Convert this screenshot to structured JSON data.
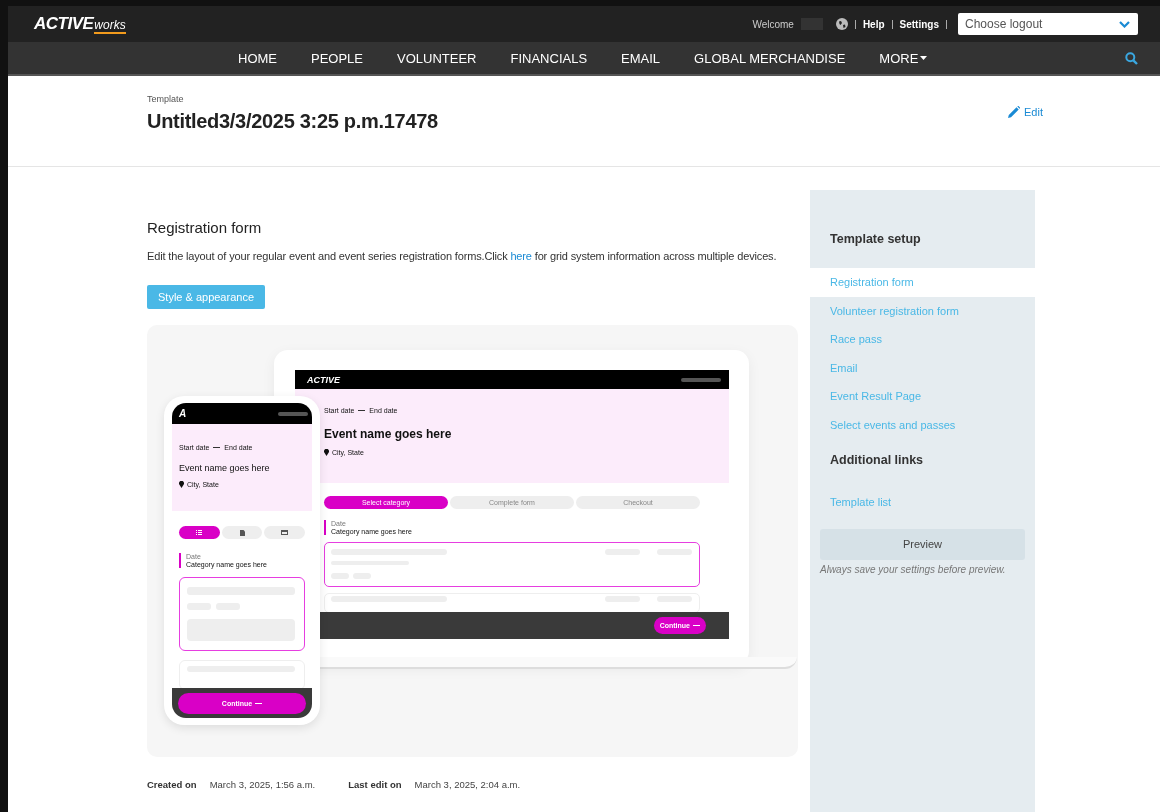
{
  "top_bar": {
    "logo": "ACTIVE",
    "logo_suffix": "works",
    "welcome": "Welcome",
    "help": "Help",
    "settings": "Settings",
    "logout_select": {
      "placeholder": "Choose logout"
    }
  },
  "nav": [
    {
      "label": "HOME",
      "kind": "link"
    },
    {
      "label": "PEOPLE",
      "kind": "link"
    },
    {
      "label": "VOLUNTEER",
      "kind": "link"
    },
    {
      "label": "FINANCIALS",
      "kind": "link"
    },
    {
      "label": "EMAIL",
      "kind": "link"
    },
    {
      "label": "GLOBAL MERCHANDISE",
      "kind": "link"
    },
    {
      "label": "MORE",
      "kind": "menu"
    }
  ],
  "header": {
    "eyebrow": "Template",
    "title": "Untitled3/3/2025 3:25 p.m.17478",
    "edit": "Edit"
  },
  "section": {
    "title": "Registration form",
    "description_before": "Edit the layout of your regular event and event series registration forms.Click",
    "link": "here",
    "description_after": "for grid system information across multiple devices.",
    "button": "Style & appearance"
  },
  "preview": {
    "desktop": {
      "logo": "ACTIVE",
      "start": "Start date",
      "end": "End date",
      "event_name": "Event name goes here",
      "location": "City, State",
      "steps": [
        {
          "label": "Select category",
          "selected": true
        },
        {
          "label": "Complete form",
          "selected": false
        },
        {
          "label": "Checkout",
          "selected": false
        }
      ],
      "category_label": "Date",
      "category_name": "Category name goes here",
      "continue": "Continue"
    },
    "mobile": {
      "logo": "A",
      "start": "Start date",
      "end": "End date",
      "event_name": "Event name goes here",
      "location": "City, State",
      "tabs": [
        {
          "kind": "list",
          "selected": true
        },
        {
          "kind": "document",
          "selected": false
        },
        {
          "kind": "card",
          "selected": false
        }
      ],
      "category_label": "Date",
      "category_name": "Category name goes here",
      "continue": "Continue"
    }
  },
  "meta": [
    {
      "label": "Created on",
      "value": "March 3, 2025, 1:56 a.m."
    },
    {
      "label": "Last edit on",
      "value": "March 3, 2025, 2:04 a.m."
    }
  ],
  "sidebar": {
    "sections": [
      {
        "title": "Template setup",
        "items": [
          {
            "label": "Registration form",
            "selected": true
          },
          {
            "label": "Volunteer registration form",
            "selected": false
          },
          {
            "label": "Race pass",
            "selected": false
          },
          {
            "label": "Email",
            "selected": false
          },
          {
            "label": "Event Result Page",
            "selected": false
          },
          {
            "label": "Select events and passes",
            "selected": false
          }
        ]
      },
      {
        "title": "Additional links",
        "items": [
          {
            "label": "Template list",
            "selected": false
          }
        ]
      }
    ],
    "preview_button": "Preview",
    "note": "Always save your settings before preview."
  }
}
